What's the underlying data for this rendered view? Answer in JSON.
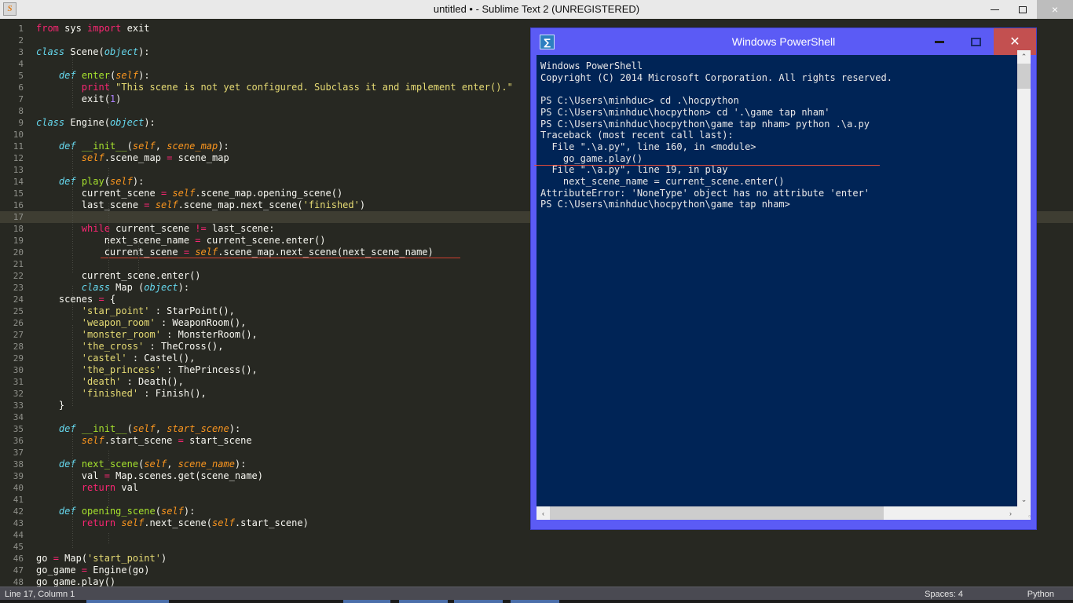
{
  "sublime": {
    "title": "untitled • - Sublime Text 2 (UNREGISTERED)",
    "app_icon": "S",
    "window_controls": {
      "minimize": "—",
      "maximize": "❐",
      "close": "×"
    },
    "status": {
      "position": "Line 17, Column 1",
      "spaces": "Spaces: 4",
      "language": "Python"
    },
    "current_line": 17,
    "colors": {
      "background": "#272822",
      "current_line": "#3e3d32",
      "keyword": "#f92672",
      "class_def": "#66d9ef",
      "function": "#a6e22e",
      "param": "#fd971f",
      "string": "#e6db74",
      "number": "#ae81ff",
      "plain": "#f8f8f2",
      "gutter_text": "#8f908a",
      "error_underline": "#d04030"
    },
    "code_lines": [
      {
        "n": 1,
        "text": "from sys import exit"
      },
      {
        "n": 2,
        "text": ""
      },
      {
        "n": 3,
        "text": "class Scene(object):"
      },
      {
        "n": 4,
        "text": ""
      },
      {
        "n": 5,
        "text": "    def enter(self):"
      },
      {
        "n": 6,
        "text": "        print \"This scene is not yet configured. Subclass it and implement enter().\""
      },
      {
        "n": 7,
        "text": "        exit(1)"
      },
      {
        "n": 8,
        "text": ""
      },
      {
        "n": 9,
        "text": "class Engine(object):"
      },
      {
        "n": 10,
        "text": ""
      },
      {
        "n": 11,
        "text": "    def __init__(self, scene_map):"
      },
      {
        "n": 12,
        "text": "        self.scene_map = scene_map"
      },
      {
        "n": 13,
        "text": ""
      },
      {
        "n": 14,
        "text": "    def play(self):"
      },
      {
        "n": 15,
        "text": "        current_scene = self.scene_map.opening_scene()"
      },
      {
        "n": 16,
        "text": "        last_scene = self.scene_map.next_scene('finished')"
      },
      {
        "n": 17,
        "text": ""
      },
      {
        "n": 18,
        "text": "        while current_scene != last_scene:"
      },
      {
        "n": 19,
        "text": "            next_scene_name = current_scene.enter()"
      },
      {
        "n": 20,
        "text": "            current_scene = self.scene_map.next_scene(next_scene_name)"
      },
      {
        "n": 21,
        "text": ""
      },
      {
        "n": 22,
        "text": "        current_scene.enter()"
      },
      {
        "n": 23,
        "text": "        class Map (object):"
      },
      {
        "n": 24,
        "text": "    scenes = {"
      },
      {
        "n": 25,
        "text": "        'star_point' : StarPoint(),"
      },
      {
        "n": 26,
        "text": "        'weapon_room' : WeaponRoom(),"
      },
      {
        "n": 27,
        "text": "        'monster_room' : MonsterRoom(),"
      },
      {
        "n": 28,
        "text": "        'the_cross' : TheCross(),"
      },
      {
        "n": 29,
        "text": "        'castel' : Castel(),"
      },
      {
        "n": 30,
        "text": "        'the_princess' : ThePrincess(),"
      },
      {
        "n": 31,
        "text": "        'death' : Death(),"
      },
      {
        "n": 32,
        "text": "        'finished' : Finish(),"
      },
      {
        "n": 33,
        "text": "    }"
      },
      {
        "n": 34,
        "text": ""
      },
      {
        "n": 35,
        "text": "    def __init__(self, start_scene):"
      },
      {
        "n": 36,
        "text": "        self.start_scene = start_scene"
      },
      {
        "n": 37,
        "text": ""
      },
      {
        "n": 38,
        "text": "    def next_scene(self, scene_name):"
      },
      {
        "n": 39,
        "text": "        val = Map.scenes.get(scene_name)"
      },
      {
        "n": 40,
        "text": "        return val"
      },
      {
        "n": 41,
        "text": ""
      },
      {
        "n": 42,
        "text": "    def opening_scene(self):"
      },
      {
        "n": 43,
        "text": "        return self.next_scene(self.start_scene)"
      },
      {
        "n": 44,
        "text": ""
      },
      {
        "n": 45,
        "text": ""
      },
      {
        "n": 46,
        "text": "go = Map('start_point')"
      },
      {
        "n": 47,
        "text": "go_game = Engine(go)"
      },
      {
        "n": 48,
        "text": "go_game.play()"
      }
    ]
  },
  "powershell": {
    "title": "Windows PowerShell",
    "app_icon": "∑",
    "window_controls": {
      "minimize": "—",
      "maximize": "❐",
      "close": "✕"
    },
    "colors": {
      "titlebar": "#5b5bf5",
      "console_bg": "#002456",
      "close_bg": "#c35050",
      "error_underline": "#e04a3a"
    },
    "console_lines": [
      "Windows PowerShell",
      "Copyright (C) 2014 Microsoft Corporation. All rights reserved.",
      "",
      "PS C:\\Users\\minhduc> cd .\\hocpython",
      "PS C:\\Users\\minhduc\\hocpython> cd '.\\game tap nham'",
      "PS C:\\Users\\minhduc\\hocpython\\game tap nham> python .\\a.py",
      "Traceback (most recent call last):",
      "  File \".\\a.py\", line 160, in <module>",
      "    go_game.play()",
      "  File \".\\a.py\", line 19, in play",
      "    next_scene_name = current_scene.enter()",
      "AttributeError: 'NoneType' object has no attribute 'enter'",
      "PS C:\\Users\\minhduc\\hocpython\\game tap nham>"
    ],
    "scrollbars": {
      "vertical_up": "⌃",
      "vertical_down": "⌄",
      "horizontal_left": "‹",
      "horizontal_right": "›"
    }
  }
}
